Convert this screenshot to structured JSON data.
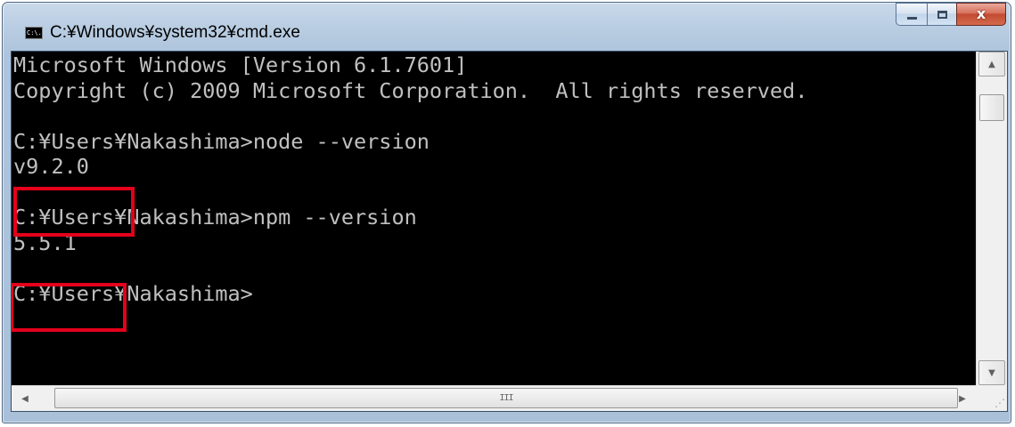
{
  "window": {
    "title": "C:¥Windows¥system32¥cmd.exe",
    "app_icon_text": "C:\\."
  },
  "console": {
    "lines": [
      "Microsoft Windows [Version 6.1.7601]",
      "Copyright (c) 2009 Microsoft Corporation.  All rights reserved.",
      "",
      "C:¥Users¥Nakashima>node --version",
      "v9.2.0",
      "",
      "C:¥Users¥Nakashima>npm --version",
      "5.5.1",
      "",
      "C:¥Users¥Nakashima>"
    ]
  },
  "scrollbar": {
    "up_arrow": "▲",
    "down_arrow": "▼",
    "left_arrow": "◀",
    "right_arrow": "▶",
    "grip": "III"
  },
  "colors": {
    "console_bg": "#000000",
    "console_fg": "#c0c0c0",
    "highlight": "#e4001b"
  }
}
